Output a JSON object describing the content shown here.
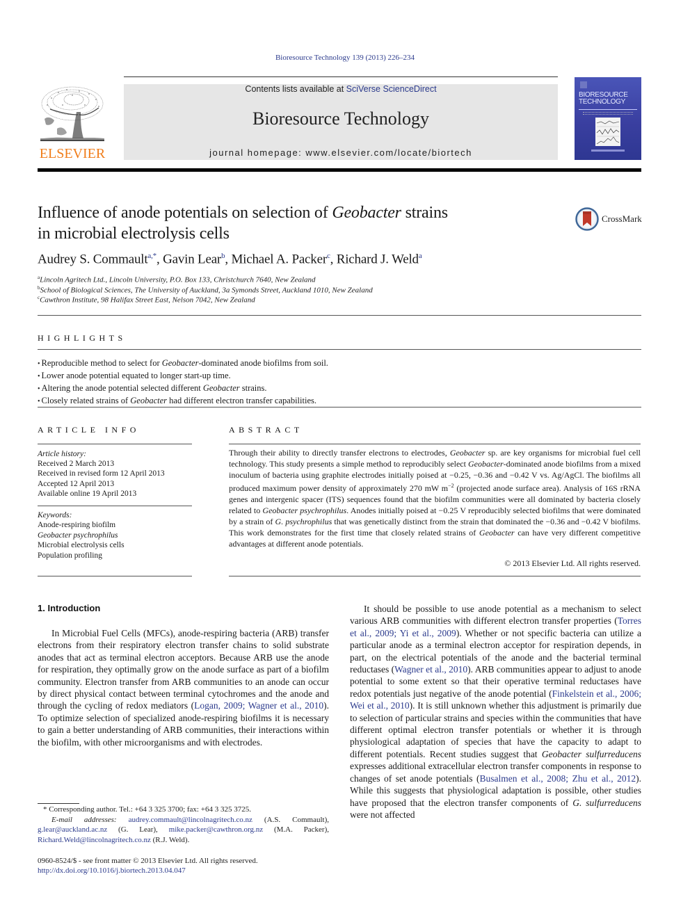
{
  "running_header": "Bioresource Technology 139 (2013) 226–234",
  "masthead": {
    "publisher_logo_text": "ELSEVIER",
    "contents_prefix": "Contents lists available at ",
    "contents_link": "SciVerse ScienceDirect",
    "journal_title": "Bioresource Technology",
    "homepage": "journal homepage: www.elsevier.com/locate/biortech",
    "cover_title_line1": "BIORESOURCE",
    "cover_title_line2": "TECHNOLOGY"
  },
  "crossmark_label": "CrossMark",
  "article": {
    "title_part1": "Influence of anode potentials on selection of ",
    "title_italic": "Geobacter",
    "title_part2": " strains",
    "title_line2": "in microbial electrolysis cells",
    "authors": [
      {
        "name": "Audrey S. Commault",
        "sup": "a,*",
        "sep": ", "
      },
      {
        "name": "Gavin Lear",
        "sup": "b",
        "sep": ", "
      },
      {
        "name": "Michael A. Packer",
        "sup": "c",
        "sep": ", "
      },
      {
        "name": "Richard J. Weld",
        "sup": "a",
        "sep": ""
      }
    ],
    "affiliations": [
      {
        "key": "a",
        "text": "Lincoln Agritech Ltd., Lincoln University, P.O. Box 133, Christchurch 7640, New Zealand"
      },
      {
        "key": "b",
        "text": "School of Biological Sciences, The University of Auckland, 3a Symonds Street, Auckland 1010, New Zealand"
      },
      {
        "key": "c",
        "text": "Cawthron Institute, 98 Halifax Street East, Nelson 7042, New Zealand"
      }
    ]
  },
  "highlights": {
    "heading": "HIGHLIGHTS",
    "items": [
      {
        "pre": "Reproducible method to select for ",
        "it": "Geobacter",
        "post": "-dominated anode biofilms from soil."
      },
      {
        "pre": "Lower anode potential equated to longer start-up time.",
        "it": "",
        "post": ""
      },
      {
        "pre": "Altering the anode potential selected different ",
        "it": "Geobacter",
        "post": " strains."
      },
      {
        "pre": "Closely related strains of ",
        "it": "Geobacter",
        "post": " had different electron transfer capabilities."
      }
    ]
  },
  "article_info": {
    "heading": "ARTICLE INFO",
    "history_label": "Article history:",
    "history": [
      "Received 2 March 2013",
      "Received in revised form 12 April 2013",
      "Accepted 12 April 2013",
      "Available online 19 April 2013"
    ],
    "keywords_label": "Keywords:",
    "keywords": [
      {
        "text": "Anode-respiring biofilm",
        "italic": false
      },
      {
        "text": "Geobacter psychrophilus",
        "italic": true
      },
      {
        "text": "Microbial electrolysis cells",
        "italic": false
      },
      {
        "text": "Population profiling",
        "italic": false
      }
    ]
  },
  "abstract": {
    "heading": "ABSTRACT",
    "segments": [
      {
        "t": "Through their ability to directly transfer electrons to electrodes, "
      },
      {
        "t": "Geobacter",
        "i": true
      },
      {
        "t": " sp. are key organisms for microbial fuel cell technology. This study presents a simple method to reproducibly select "
      },
      {
        "t": "Geobacter",
        "i": true
      },
      {
        "t": "-dominated anode biofilms from a mixed inoculum of bacteria using graphite electrodes initially poised at −0.25, −0.36 and −0.42 V vs. Ag/AgCl. The biofilms all produced maximum power density of approximately 270 mW m"
      },
      {
        "t": "−2",
        "sup": true
      },
      {
        "t": " (projected anode surface area). Analysis of 16S rRNA genes and intergenic spacer (ITS) sequences found that the biofilm communities were all dominated by bacteria closely related to "
      },
      {
        "t": "Geobacter psychrophilus",
        "i": true
      },
      {
        "t": ". Anodes initially poised at −0.25 V reproducibly selected biofilms that were dominated by a strain of "
      },
      {
        "t": "G. psychrophilus",
        "i": true
      },
      {
        "t": " that was genetically distinct from the strain that dominated the −0.36 and −0.42 V biofilms. This work demonstrates for the first time that closely related strains of "
      },
      {
        "t": "Geobacter",
        "i": true
      },
      {
        "t": " can have very different competitive advantages at different anode potentials."
      }
    ],
    "copyright": "© 2013 Elsevier Ltd. All rights reserved."
  },
  "introduction": {
    "heading": "1. Introduction",
    "left_segments": [
      {
        "t": "In Microbial Fuel Cells (MFCs), anode-respiring bacteria (ARB) transfer electrons from their respiratory electron transfer chains to solid substrate anodes that act as terminal electron acceptors. Because ARB use the anode for respiration, they optimally grow on the anode surface as part of a biofilm community. Electron transfer from ARB communities to an anode can occur by direct physical contact between terminal cytochromes and the anode and through the cycling of redox mediators ("
      },
      {
        "t": "Logan, 2009; Wagner et al., 2010",
        "link": true
      },
      {
        "t": "). To optimize selection of specialized anode-respiring biofilms it is necessary to gain a better understanding of ARB communities, their interactions within the biofilm, with other microorganisms and with electrodes."
      }
    ],
    "right_segments": [
      {
        "t": "It should be possible to use anode potential as a mechanism to select various ARB communities with different electron transfer properties ("
      },
      {
        "t": "Torres et al., 2009; Yi et al., 2009",
        "link": true
      },
      {
        "t": "). Whether or not specific bacteria can utilize a particular anode as a terminal electron acceptor for respiration depends, in part, on the electrical potentials of the anode and the bacterial terminal reductases ("
      },
      {
        "t": "Wagner et al., 2010",
        "link": true
      },
      {
        "t": "). ARB communities appear to adjust to anode potential to some extent so that their operative terminal reductases have redox potentials just negative of the anode potential ("
      },
      {
        "t": "Finkelstein et al., 2006; Wei et al., 2010",
        "link": true
      },
      {
        "t": "). It is still unknown whether this adjustment is primarily due to selection of particular strains and species within the communities that have different optimal electron transfer potentials or whether it is through physiological adaptation of species that have the capacity to adapt to different potentials. Recent studies suggest that "
      },
      {
        "t": "Geobacter sulfurreducens",
        "i": true
      },
      {
        "t": " expresses additional extracellular electron transfer components in response to changes of set anode potentials ("
      },
      {
        "t": "Busalmen et al., 2008; Zhu et al., 2012",
        "link": true
      },
      {
        "t": "). While this suggests that physiological adaptation is possible, other studies have proposed that the electron transfer components of "
      },
      {
        "t": "G. sulfurreducens",
        "i": true
      },
      {
        "t": " were not affected"
      }
    ]
  },
  "footnotes": {
    "corresponding": "* Corresponding author. Tel.: +64 3 325 3700; fax: +64 3 325 3725.",
    "email_label": "E-mail addresses:",
    "emails": [
      {
        "addr": "audrey.commault@lincolnagritech.co.nz",
        "who": " (A.S. Commault), "
      },
      {
        "addr": "g.lear@auckland.ac.nz",
        "who": " (G. Lear), "
      },
      {
        "addr": "mike.packer@cawthron.org.nz",
        "who": " (M.A. Packer), "
      },
      {
        "addr": "Richard.Weld@lincolnagritech.co.nz",
        "who": " (R.J. Weld)."
      }
    ]
  },
  "front_matter": {
    "issn_line": "0960-8524/$ - see front matter © 2013 Elsevier Ltd. All rights reserved.",
    "doi": "http://dx.doi.org/10.1016/j.biortech.2013.04.047"
  },
  "colors": {
    "link": "#2b3a8c",
    "elsevier_orange": "#f07d1a",
    "masthead_gray": "#e6e6e6",
    "cover_blue": "#3a3fa0"
  }
}
